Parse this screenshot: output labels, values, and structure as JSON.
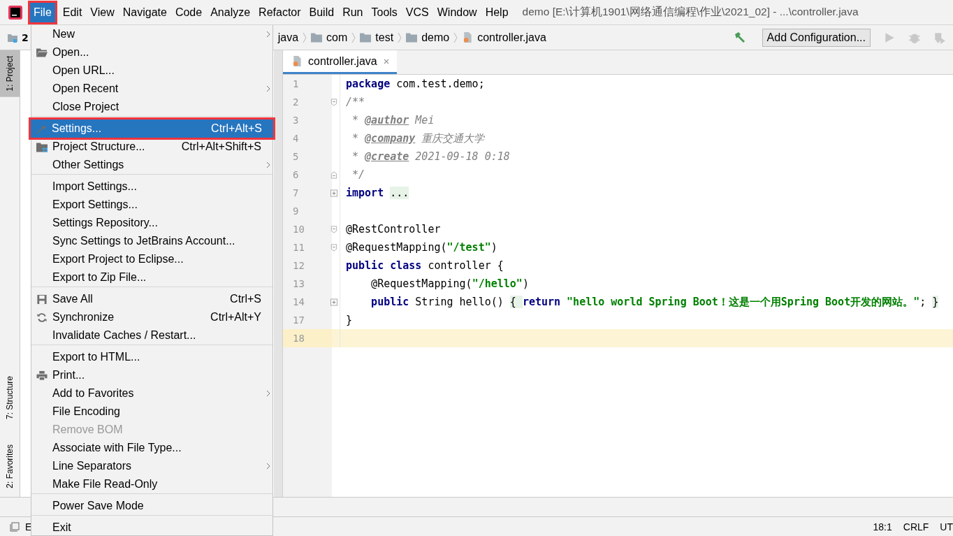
{
  "menubar": [
    {
      "label": "File",
      "selected": true
    },
    {
      "label": "Edit",
      "selected": false
    },
    {
      "label": "View",
      "selected": false
    },
    {
      "label": "Navigate",
      "selected": false
    },
    {
      "label": "Code",
      "selected": false
    },
    {
      "label": "Analyze",
      "selected": false
    },
    {
      "label": "Refactor",
      "selected": false
    },
    {
      "label": "Build",
      "selected": false
    },
    {
      "label": "Run",
      "selected": false
    },
    {
      "label": "Tools",
      "selected": false
    },
    {
      "label": "VCS",
      "selected": false
    },
    {
      "label": "Window",
      "selected": false
    },
    {
      "label": "Help",
      "selected": false
    }
  ],
  "window": {
    "title": "demo [E:\\计算机1901\\网络通信编程\\作业\\2021_02] - ...\\controller.java"
  },
  "toolbar": {
    "project": "2",
    "breadcrumbs": [
      "java",
      "com",
      "test",
      "demo",
      "controller.java"
    ],
    "run_config": "Add Configuration..."
  },
  "tool_strip_top": [
    {
      "label": "1: Project",
      "selected": true
    }
  ],
  "tool_strip_bottom": [
    {
      "label": "7: Structure",
      "selected": false
    },
    {
      "label": "2: Favorites",
      "selected": false
    }
  ],
  "editor_tabs": [
    {
      "label": "controller.java",
      "selected": true
    }
  ],
  "code": [
    {
      "number": "1",
      "kind": "plain",
      "current": false,
      "tokens": [
        {
          "kind": "kw",
          "text": "package"
        },
        {
          "kind": "plain",
          "text": " com.test.demo;"
        }
      ]
    },
    {
      "number": "2",
      "kind": "open",
      "current": false,
      "tokens": [
        {
          "kind": "doc",
          "text": "/**"
        }
      ]
    },
    {
      "number": "3",
      "kind": "plain",
      "current": false,
      "tokens": [
        {
          "kind": "doc",
          "text": " * "
        },
        {
          "kind": "doctag",
          "text": "@author"
        },
        {
          "kind": "doc",
          "text": " Mei"
        }
      ]
    },
    {
      "number": "4",
      "kind": "plain",
      "current": false,
      "tokens": [
        {
          "kind": "doc",
          "text": " * "
        },
        {
          "kind": "doctag",
          "text": "@company"
        },
        {
          "kind": "doc",
          "text": " 重庆交通大学"
        }
      ]
    },
    {
      "number": "5",
      "kind": "plain",
      "current": false,
      "tokens": [
        {
          "kind": "doc",
          "text": " * "
        },
        {
          "kind": "doctag",
          "text": "@create"
        },
        {
          "kind": "doc",
          "text": " 2021-09-18 0:18"
        }
      ]
    },
    {
      "number": "6",
      "kind": "close",
      "current": false,
      "tokens": [
        {
          "kind": "doc",
          "text": " */"
        }
      ]
    },
    {
      "number": "7",
      "kind": "folded",
      "current": false,
      "tokens": [
        {
          "kind": "kw",
          "text": "import "
        },
        {
          "kind": "folded",
          "text": "..."
        }
      ]
    },
    {
      "number": "9",
      "kind": "plain",
      "current": false
    },
    {
      "number": "10",
      "kind": "open",
      "current": false,
      "tokens": [
        {
          "kind": "plain",
          "text": "@RestController"
        }
      ]
    },
    {
      "number": "11",
      "kind": "open",
      "current": false,
      "tokens": [
        {
          "kind": "plain",
          "text": "@RequestMapping("
        },
        {
          "kind": "str",
          "text": "\"/test\""
        },
        {
          "kind": "plain",
          "text": ")"
        }
      ]
    },
    {
      "number": "12",
      "kind": "plain",
      "current": false,
      "tokens": [
        {
          "kind": "kw",
          "text": "public class"
        },
        {
          "kind": "plain",
          "text": " controller {"
        }
      ]
    },
    {
      "number": "13",
      "kind": "plain",
      "current": false,
      "tokens": [
        {
          "kind": "plain",
          "text": "    @RequestMapping("
        },
        {
          "kind": "str",
          "text": "\"/hello\""
        },
        {
          "kind": "plain",
          "text": ")"
        }
      ]
    },
    {
      "number": "14",
      "kind": "folded",
      "current": false,
      "tokens": [
        {
          "kind": "kw",
          "text": "    public"
        },
        {
          "kind": "plain",
          "text": " String hello() "
        },
        {
          "kind": "folded",
          "text": "{ "
        },
        {
          "kind": "kw",
          "text": "return "
        },
        {
          "kind": "str",
          "text": "\"hello world Spring Boot！这是一个用Spring Boot开发的网站。\""
        },
        {
          "kind": "plain",
          "text": "; "
        },
        {
          "kind": "folded",
          "text": "}"
        }
      ]
    },
    {
      "number": "17",
      "kind": "plain",
      "current": false,
      "tokens": [
        {
          "kind": "plain",
          "text": "}"
        }
      ]
    },
    {
      "number": "18",
      "kind": "plain",
      "current": true
    }
  ],
  "file_menu": [
    {
      "kind": "item",
      "label": "New",
      "submenu": true,
      "disabled": false,
      "selected": false
    },
    {
      "kind": "item",
      "label": "Open...",
      "submenu": false,
      "disabled": false,
      "selected": false
    },
    {
      "kind": "item",
      "label": "Open URL...",
      "submenu": false,
      "disabled": false,
      "selected": false
    },
    {
      "kind": "item",
      "label": "Open Recent",
      "submenu": true,
      "disabled": false,
      "selected": false
    },
    {
      "kind": "item",
      "label": "Close Project",
      "submenu": false,
      "disabled": false,
      "selected": false
    },
    {
      "kind": "separator"
    },
    {
      "kind": "item",
      "label": "Settings...",
      "shortcut": "Ctrl+Alt+S",
      "submenu": false,
      "disabled": false,
      "selected": true
    },
    {
      "kind": "item",
      "label": "Project Structure...",
      "shortcut": "Ctrl+Alt+Shift+S",
      "submenu": false,
      "disabled": false,
      "selected": false
    },
    {
      "kind": "item",
      "label": "Other Settings",
      "submenu": true,
      "disabled": false,
      "selected": false
    },
    {
      "kind": "separator"
    },
    {
      "kind": "item",
      "label": "Import Settings...",
      "submenu": false,
      "disabled": false,
      "selected": false
    },
    {
      "kind": "item",
      "label": "Export Settings...",
      "submenu": false,
      "disabled": false,
      "selected": false
    },
    {
      "kind": "item",
      "label": "Settings Repository...",
      "submenu": false,
      "disabled": false,
      "selected": false
    },
    {
      "kind": "item",
      "label": "Sync Settings to JetBrains Account...",
      "submenu": false,
      "disabled": false,
      "selected": false
    },
    {
      "kind": "item",
      "label": "Export Project to Eclipse...",
      "submenu": false,
      "disabled": false,
      "selected": false
    },
    {
      "kind": "item",
      "label": "Export to Zip File...",
      "submenu": false,
      "disabled": false,
      "selected": false
    },
    {
      "kind": "separator"
    },
    {
      "kind": "item",
      "label": "Save All",
      "shortcut": "Ctrl+S",
      "submenu": false,
      "disabled": false,
      "selected": false
    },
    {
      "kind": "item",
      "label": "Synchronize",
      "shortcut": "Ctrl+Alt+Y",
      "submenu": false,
      "disabled": false,
      "selected": false
    },
    {
      "kind": "item",
      "label": "Invalidate Caches / Restart...",
      "submenu": false,
      "disabled": false,
      "selected": false
    },
    {
      "kind": "separator"
    },
    {
      "kind": "item",
      "label": "Export to HTML...",
      "submenu": false,
      "disabled": false,
      "selected": false
    },
    {
      "kind": "item",
      "label": "Print...",
      "submenu": false,
      "disabled": false,
      "selected": false
    },
    {
      "kind": "item",
      "label": "Add to Favorites",
      "submenu": true,
      "disabled": false,
      "selected": false
    },
    {
      "kind": "item",
      "label": "File Encoding",
      "submenu": false,
      "disabled": false,
      "selected": false
    },
    {
      "kind": "item",
      "label": "Remove BOM",
      "submenu": false,
      "disabled": true,
      "selected": false
    },
    {
      "kind": "item",
      "label": "Associate with File Type...",
      "submenu": false,
      "disabled": false,
      "selected": false
    },
    {
      "kind": "item",
      "label": "Line Separators",
      "submenu": true,
      "disabled": false,
      "selected": false
    },
    {
      "kind": "item",
      "label": "Make File Read-Only",
      "submenu": false,
      "disabled": false,
      "selected": false
    },
    {
      "kind": "separator"
    },
    {
      "kind": "item",
      "label": "Power Save Mode",
      "submenu": false,
      "disabled": false,
      "selected": false
    },
    {
      "kind": "separator"
    },
    {
      "kind": "item",
      "label": "Exit",
      "submenu": false,
      "disabled": false,
      "selected": false
    }
  ],
  "status_bar": {
    "left": "E",
    "position": "18:1",
    "line_separator": "CRLF",
    "encoding": "UT"
  }
}
